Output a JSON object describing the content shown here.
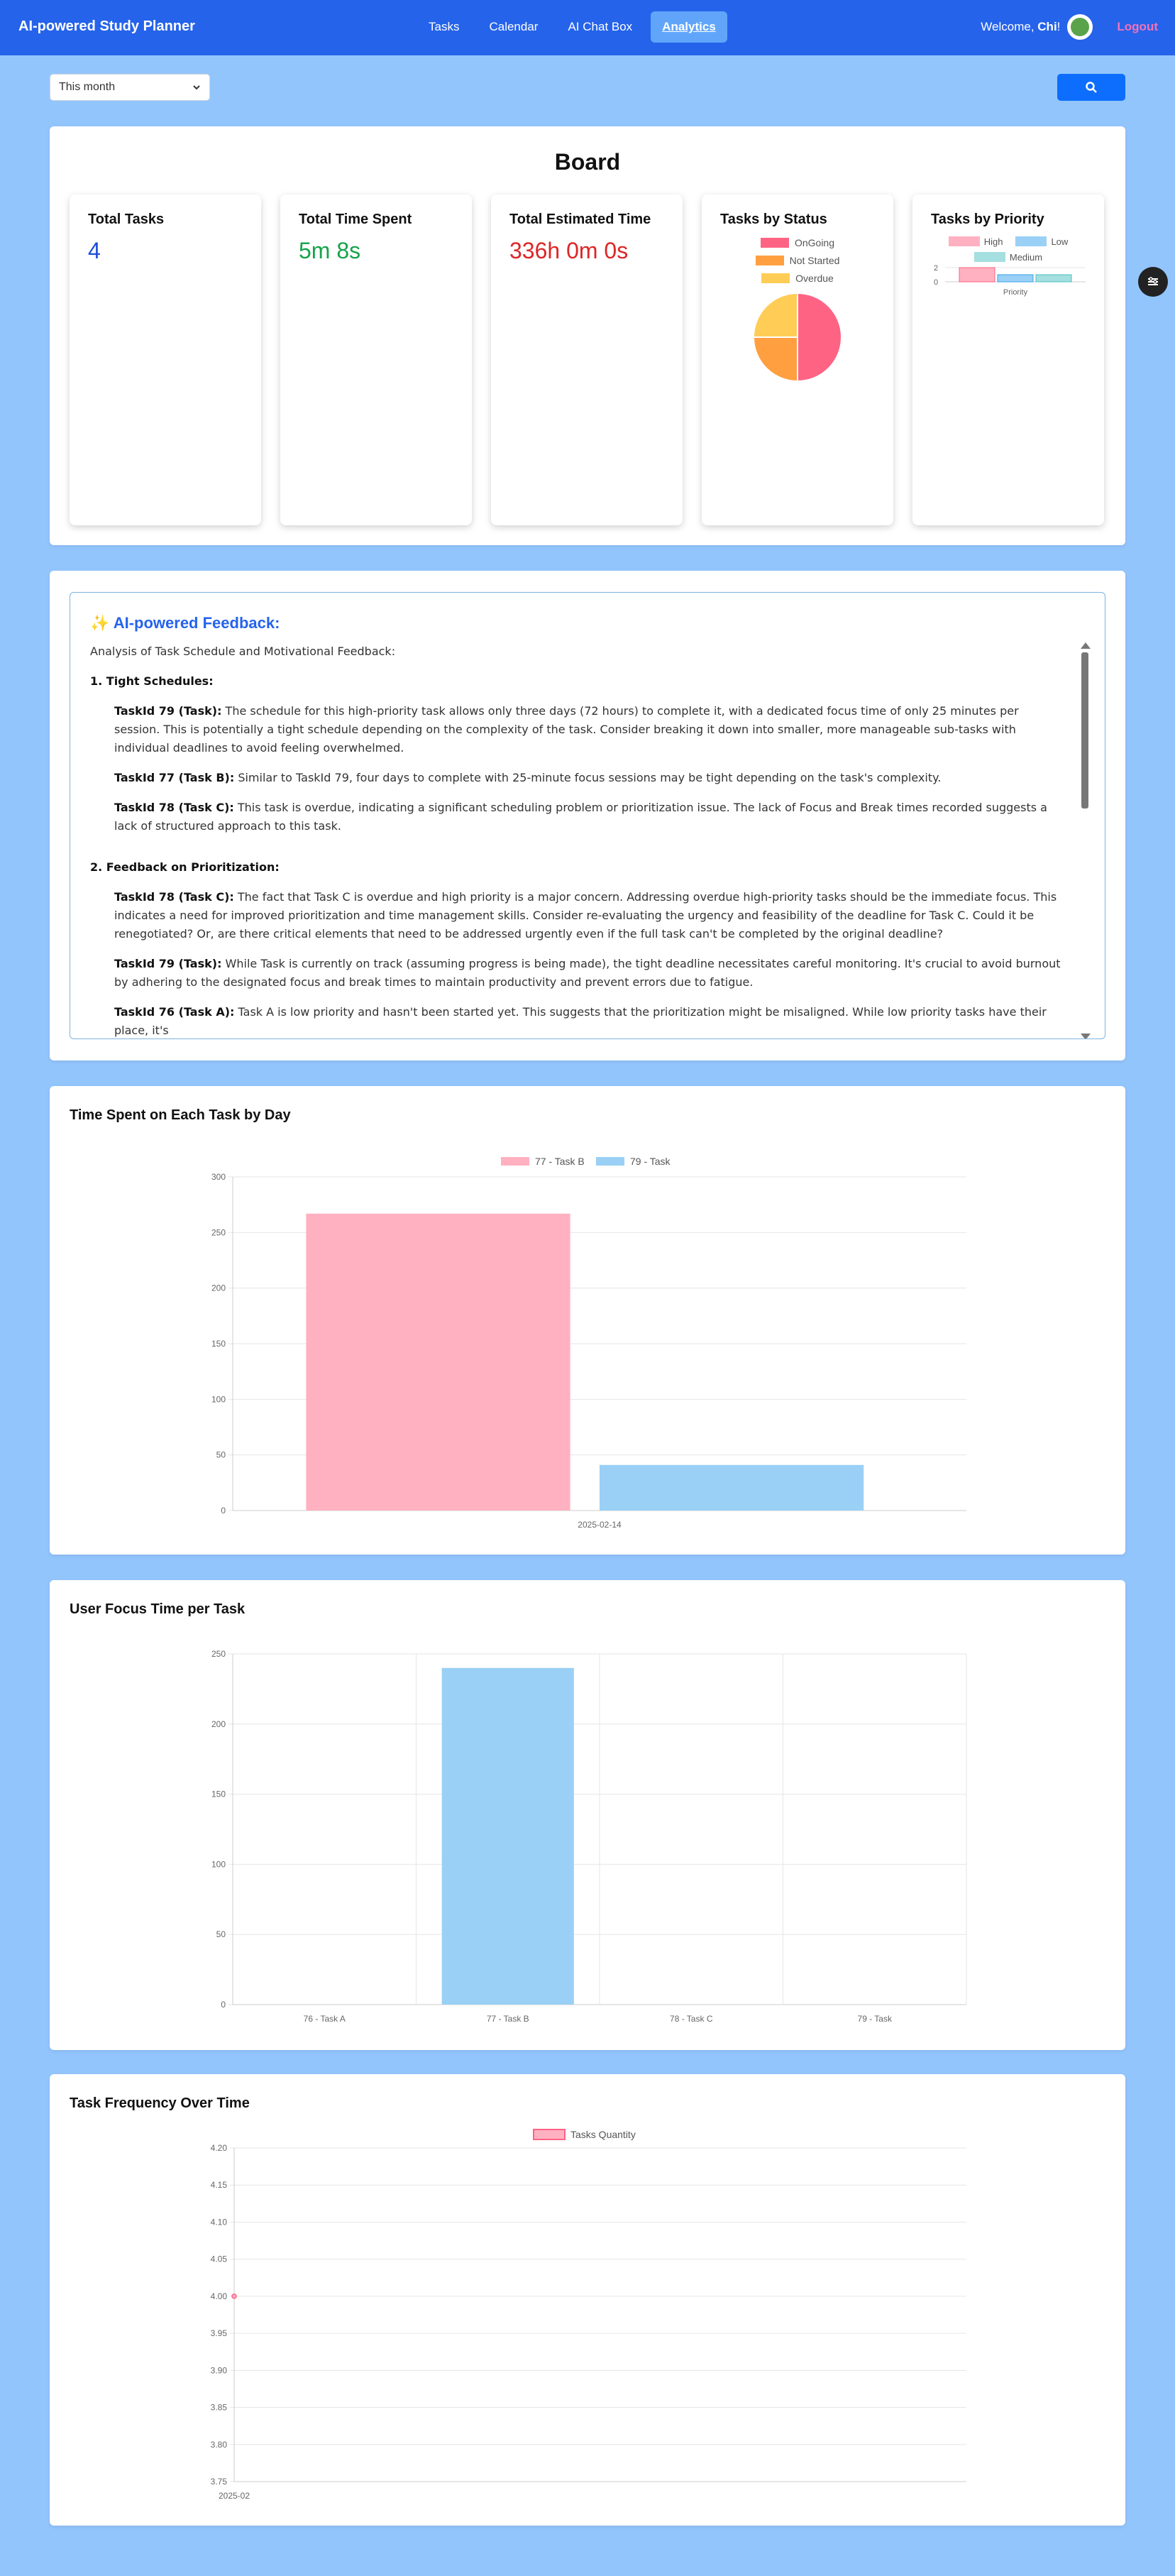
{
  "nav": {
    "brand": "AI-powered Study Planner",
    "links": [
      "Tasks",
      "Calendar",
      "AI Chat Box",
      "Analytics"
    ],
    "welcome": "Welcome,",
    "username": "Chi",
    "welcome_suffix": "!",
    "logout": "Logout"
  },
  "filter": {
    "selected": "This month"
  },
  "board": {
    "title": "Board",
    "total_tasks": {
      "label": "Total Tasks",
      "value": "4"
    },
    "total_time_spent": {
      "label": "Total Time Spent",
      "value": "5m 8s"
    },
    "total_estimated": {
      "label": "Total Estimated Time",
      "value": "336h 0m 0s"
    },
    "tasks_by_status": {
      "label": "Tasks by Status",
      "legend": [
        "OnGoing",
        "Not Started",
        "Overdue"
      ]
    },
    "tasks_by_priority": {
      "label": "Tasks by Priority",
      "legend": [
        "High",
        "Low",
        "Medium"
      ],
      "ticks": [
        "2",
        "0"
      ],
      "xlabel": "Priority"
    }
  },
  "feedback": {
    "icon": "✨",
    "title": "AI-powered Feedback:",
    "intro": "Analysis of Task Schedule and Motivational Feedback:",
    "sections": [
      {
        "heading": "1. Tight Schedules:",
        "items": [
          {
            "lead": "TaskId 79 (Task):",
            "text": " The schedule for this high-priority task allows only three days (72 hours) to complete it, with a dedicated focus time of only 25 minutes per session. This is potentially a tight schedule depending on the complexity of the task. Consider breaking it down into smaller, more manageable sub-tasks with individual deadlines to avoid feeling overwhelmed."
          },
          {
            "lead": "TaskId 77 (Task B):",
            "text": " Similar to TaskId 79, four days to complete with 25-minute focus sessions may be tight depending on the task's complexity."
          },
          {
            "lead": "TaskId 78 (Task C):",
            "text": " This task is overdue, indicating a significant scheduling problem or prioritization issue. The lack of Focus and Break times recorded suggests a lack of structured approach to this task."
          }
        ]
      },
      {
        "heading": "2. Feedback on Prioritization:",
        "items": [
          {
            "lead": "TaskId 78 (Task C):",
            "text": " The fact that Task C is overdue and high priority is a major concern. Addressing overdue high-priority tasks should be the immediate focus. This indicates a need for improved prioritization and time management skills. Consider re-evaluating the urgency and feasibility of the deadline for Task C. Could it be renegotiated? Or, are there critical elements that need to be addressed urgently even if the full task can't be completed by the original deadline?"
          },
          {
            "lead": "TaskId 79 (Task):",
            "text": " While Task is currently on track (assuming progress is being made), the tight deadline necessitates careful monitoring. It's crucial to avoid burnout by adhering to the designated focus and break times to maintain productivity and prevent errors due to fatigue."
          },
          {
            "lead": "TaskId 76 (Task A):",
            "text": " Task A is low priority and hasn't been started yet. This suggests that the prioritization might be misaligned. While low priority tasks have their place, it's"
          }
        ]
      }
    ]
  },
  "chart_time_by_day": {
    "title": "Time Spent on Each Task by Day",
    "chart_data": {
      "type": "bar",
      "categories": [
        "2025-02-14"
      ],
      "series": [
        {
          "name": "77 - Task B",
          "values": [
            267
          ],
          "color": "#ffb1c1"
        },
        {
          "name": "79 - Task",
          "values": [
            41
          ],
          "color": "#9ad0f5"
        }
      ],
      "ylim": [
        0,
        300
      ],
      "yticks": [
        "0",
        "50",
        "100",
        "150",
        "200",
        "250",
        "300"
      ],
      "grid": true,
      "legend": "top"
    }
  },
  "chart_focus": {
    "title": "User Focus Time per Task",
    "chart_data": {
      "type": "bar",
      "categories": [
        "76 - Task A",
        "77 - Task B",
        "78 - Task C",
        "79 - Task"
      ],
      "values": [
        0,
        240,
        0,
        0
      ],
      "color": "#9ad0f5",
      "ylim": [
        0,
        250
      ],
      "yticks": [
        "0",
        "50",
        "100",
        "150",
        "200",
        "250"
      ],
      "grid": true
    }
  },
  "chart_frequency": {
    "title": "Task Frequency Over Time",
    "chart_data": {
      "type": "line",
      "x": [
        "2025-02"
      ],
      "series": [
        {
          "name": "Tasks Quantity",
          "values": [
            4
          ],
          "color": "#ff6384"
        }
      ],
      "ylim": [
        3.75,
        4.2
      ],
      "yticks": [
        "3.75",
        "3.80",
        "3.85",
        "3.90",
        "3.95",
        "4.00",
        "4.05",
        "4.10",
        "4.15",
        "4.20"
      ],
      "grid": true,
      "legend": "top"
    }
  },
  "colors": {
    "nav": "#2563eb",
    "background": "#93c5fd",
    "pink": "#ff6384",
    "orange": "#ff9f40",
    "yellow": "#ffcd56",
    "blue": "#9ad0f5",
    "teal": "#a5dfdf"
  }
}
